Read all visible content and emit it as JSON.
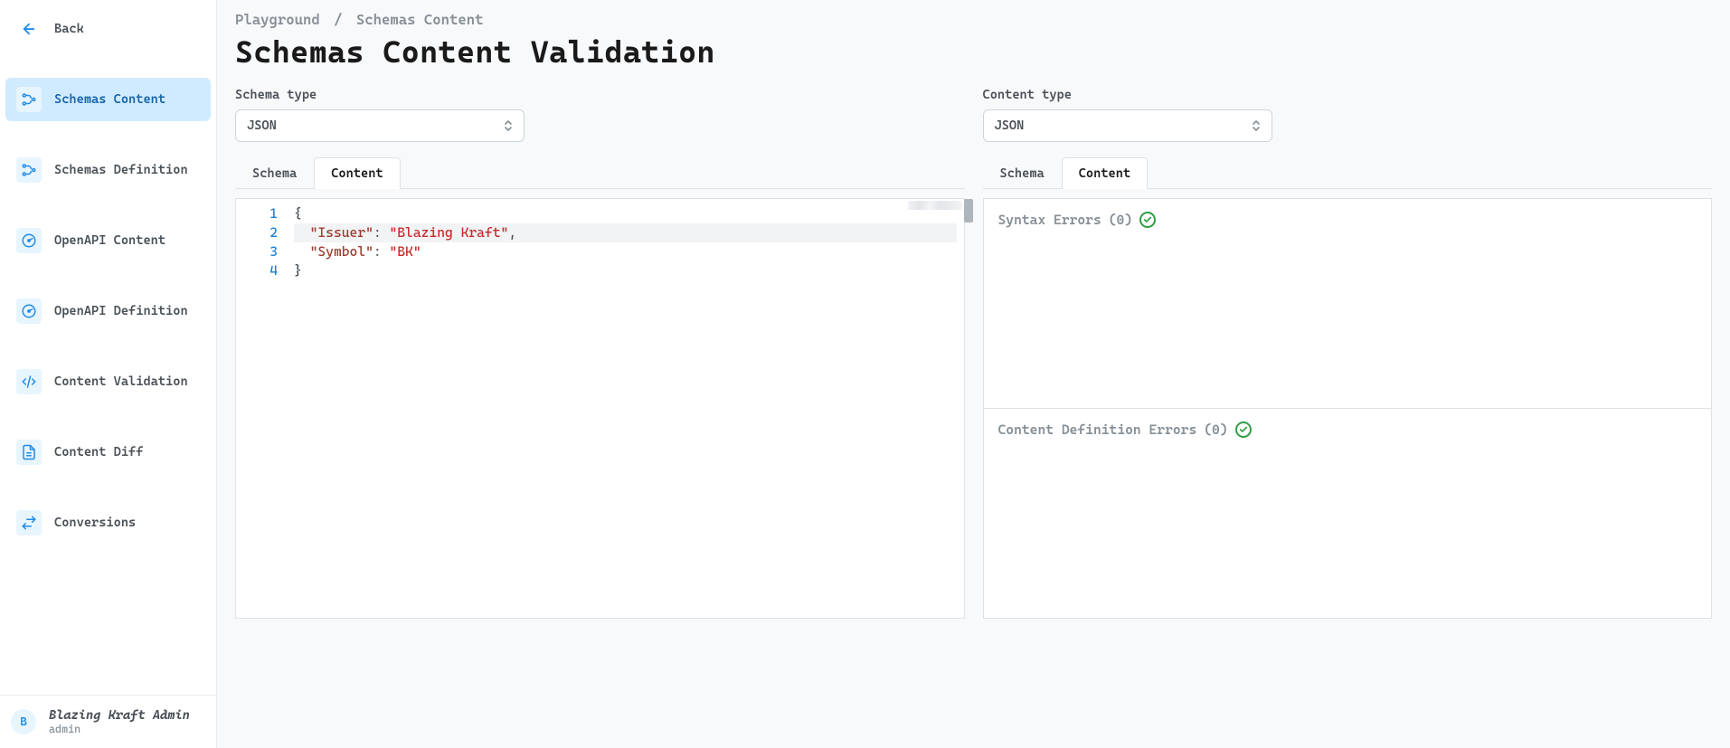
{
  "sidebar": {
    "back_label": "Back",
    "items": [
      {
        "label": "Schemas Content",
        "icon": "tree-icon",
        "active": true
      },
      {
        "label": "Schemas Definition",
        "icon": "tree-icon",
        "active": false
      },
      {
        "label": "OpenAPI Content",
        "icon": "dashboard-icon",
        "active": false
      },
      {
        "label": "OpenAPI Definition",
        "icon": "dashboard-icon",
        "active": false
      },
      {
        "label": "Content Validation",
        "icon": "code-icon",
        "active": false
      },
      {
        "label": "Content Diff",
        "icon": "document-icon",
        "active": false
      },
      {
        "label": "Conversions",
        "icon": "swap-icon",
        "active": false
      }
    ]
  },
  "user": {
    "avatar_letter": "B",
    "name": "Blazing Kraft Admin",
    "role": "admin"
  },
  "breadcrumb": {
    "root": "Playground",
    "sep": "/",
    "current": "Schemas Content"
  },
  "page_title": "Schemas Content Validation",
  "left_panel": {
    "schema_type_label": "Schema type",
    "schema_type_value": "JSON",
    "tabs": {
      "schema": "Schema",
      "content": "Content",
      "active": "content"
    },
    "editor": {
      "language": "json",
      "line_numbers": [
        "1",
        "2",
        "3",
        "4"
      ],
      "content_raw": "{\n  \"Issuer\": \"Blazing Kraft\",\n  \"Symbol\": \"BK\"\n}",
      "lines": [
        {
          "indent": "",
          "tokens": [
            {
              "t": "punc",
              "v": "{"
            }
          ]
        },
        {
          "indent": "  ",
          "tokens": [
            {
              "t": "key",
              "v": "\"Issuer\""
            },
            {
              "t": "punc",
              "v": ": "
            },
            {
              "t": "str",
              "v": "\"Blazing Kraft\""
            },
            {
              "t": "punc",
              "v": ","
            }
          ],
          "highlight": true
        },
        {
          "indent": "  ",
          "tokens": [
            {
              "t": "key",
              "v": "\"Symbol\""
            },
            {
              "t": "punc",
              "v": ": "
            },
            {
              "t": "str",
              "v": "\"BK\""
            }
          ]
        },
        {
          "indent": "",
          "tokens": [
            {
              "t": "punc",
              "v": "}"
            }
          ]
        }
      ]
    }
  },
  "right_panel": {
    "content_type_label": "Content type",
    "content_type_value": "JSON",
    "tabs": {
      "schema": "Schema",
      "content": "Content",
      "active": "content"
    },
    "syntax_errors_label": "Syntax Errors",
    "syntax_errors_count": "(0)",
    "definition_errors_label": "Content Definition Errors",
    "definition_errors_count": "(0)"
  }
}
